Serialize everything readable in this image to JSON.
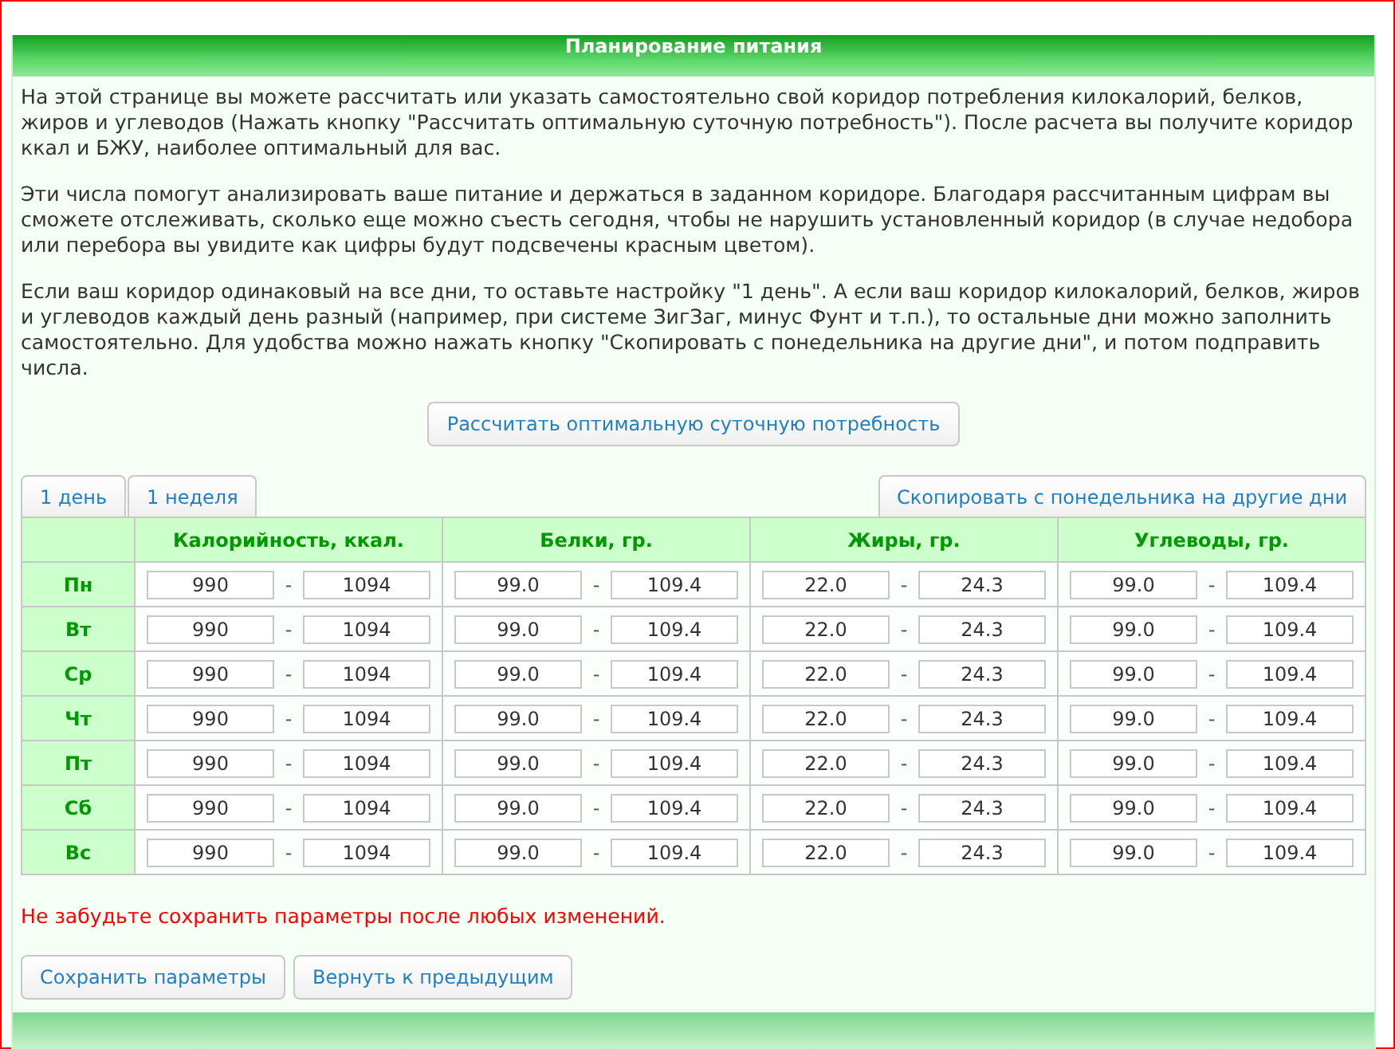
{
  "title": "Планирование питания",
  "paragraphs": [
    "На этой странице вы можете рассчитать или указать самостоятельно свой коридор потребления килокалорий, белков, жиров и углеводов (Нажать кнопку \"Рассчитать оптимальную суточную потребность\"). После расчета вы получите коридор ккал и БЖУ, наиболее оптимальный для вас.",
    "Эти числа помогут анализировать ваше питание и держаться в заданном коридоре. Благодаря рассчитанным цифрам вы сможете отслеживать, сколько еще можно съесть сегодня, чтобы не нарушить установленный коридор (в случае недобора или перебора вы увидите как цифры будут подсвечены красным цветом).",
    "Если ваш коридор одинаковый на все дни, то оставьте настройку \"1 день\". А если ваш коридор килокалорий, белков, жиров и углеводов каждый день разный (например, при системе ЗигЗаг, минус Фунт и т.п.), то остальные дни можно заполнить самостоятельно. Для удобства можно нажать кнопку \"Скопировать с понедельника на другие дни\", и потом подправить числа."
  ],
  "calc_button": "Рассчитать оптимальную суточную потребность",
  "tabs": [
    "1 день",
    "1 неделя"
  ],
  "copy_button": "Скопировать с понедельника на другие дни",
  "columns": [
    "Калорийность, ккал.",
    "Белки, гр.",
    "Жиры, гр.",
    "Углеводы, гр."
  ],
  "rows": [
    {
      "day": "Пн",
      "values": [
        [
          "990",
          "-",
          "1094"
        ],
        [
          "99.0",
          "-",
          "109.4"
        ],
        [
          "22.0",
          "-",
          "24.3"
        ],
        [
          "99.0",
          "-",
          "109.4"
        ]
      ]
    },
    {
      "day": "Вт",
      "values": [
        [
          "990",
          "-",
          "1094"
        ],
        [
          "99.0",
          "-",
          "109.4"
        ],
        [
          "22.0",
          "-",
          "24.3"
        ],
        [
          "99.0",
          "-",
          "109.4"
        ]
      ]
    },
    {
      "day": "Ср",
      "values": [
        [
          "990",
          "-",
          "1094"
        ],
        [
          "99.0",
          "-",
          "109.4"
        ],
        [
          "22.0",
          "-",
          "24.3"
        ],
        [
          "99.0",
          "-",
          "109.4"
        ]
      ]
    },
    {
      "day": "Чт",
      "values": [
        [
          "990",
          "-",
          "1094"
        ],
        [
          "99.0",
          "-",
          "109.4"
        ],
        [
          "22.0",
          "-",
          "24.3"
        ],
        [
          "99.0",
          "-",
          "109.4"
        ]
      ]
    },
    {
      "day": "Пт",
      "values": [
        [
          "990",
          "-",
          "1094"
        ],
        [
          "99.0",
          "-",
          "109.4"
        ],
        [
          "22.0",
          "-",
          "24.3"
        ],
        [
          "99.0",
          "-",
          "109.4"
        ]
      ]
    },
    {
      "day": "Сб",
      "values": [
        [
          "990",
          "-",
          "1094"
        ],
        [
          "99.0",
          "-",
          "109.4"
        ],
        [
          "22.0",
          "-",
          "24.3"
        ],
        [
          "99.0",
          "-",
          "109.4"
        ]
      ]
    },
    {
      "day": "Вс",
      "values": [
        [
          "990",
          "-",
          "1094"
        ],
        [
          "99.0",
          "-",
          "109.4"
        ],
        [
          "22.0",
          "-",
          "24.3"
        ],
        [
          "99.0",
          "-",
          "109.4"
        ]
      ]
    }
  ],
  "warning": "Не забудьте сохранить параметры после любых изменений.",
  "buttons": [
    "Сохранить параметры",
    "Вернуть к предыдущим"
  ]
}
